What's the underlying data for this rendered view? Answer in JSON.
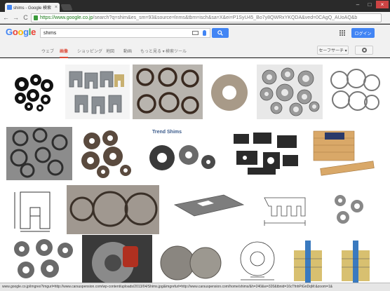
{
  "window": {
    "tab_title": "shims - Google 検索",
    "min_label": "–",
    "max_label": "□",
    "close_label": "×",
    "tab_close_label": "×"
  },
  "toolbar": {
    "back_label": "←",
    "forward_label": "→",
    "reload_label": "C",
    "url_host": "https://www.google.co.jp",
    "url_rest": "/search?q=shim&es_sm=93&source=lnms&tbm=isch&sa=X&ei=P1SyU45_Bo7y8QWRxYKQDA&ved=0CAgQ_AUoAQ&b"
  },
  "header": {
    "logo_letters": [
      "G",
      "o",
      "o",
      "g",
      "l",
      "e"
    ],
    "search_value": "shims",
    "login_label": "ログイン"
  },
  "search_tabs": [
    {
      "label": "ウェブ"
    },
    {
      "label": "画像"
    },
    {
      "label": "ショッピング"
    },
    {
      "label": "地図"
    },
    {
      "label": "動画"
    },
    {
      "label": "もっと見る ▾"
    },
    {
      "label": "検索ツール"
    }
  ],
  "safesearch_label": "セーフサーチ ▾",
  "results": {
    "trend_shims_text": "Trend Shims"
  },
  "status_bar_text": "www.google.co.jp/imgres?imgurl=http://www.carsuspension.com/wp-content/uploads/2013/04/Shims.jpg&imgrefurl=http://www.carsuspension.com/home/shims/&h=240&w=320&tbnid=16cTfnhPiGnDqM:&zoom=1&"
}
